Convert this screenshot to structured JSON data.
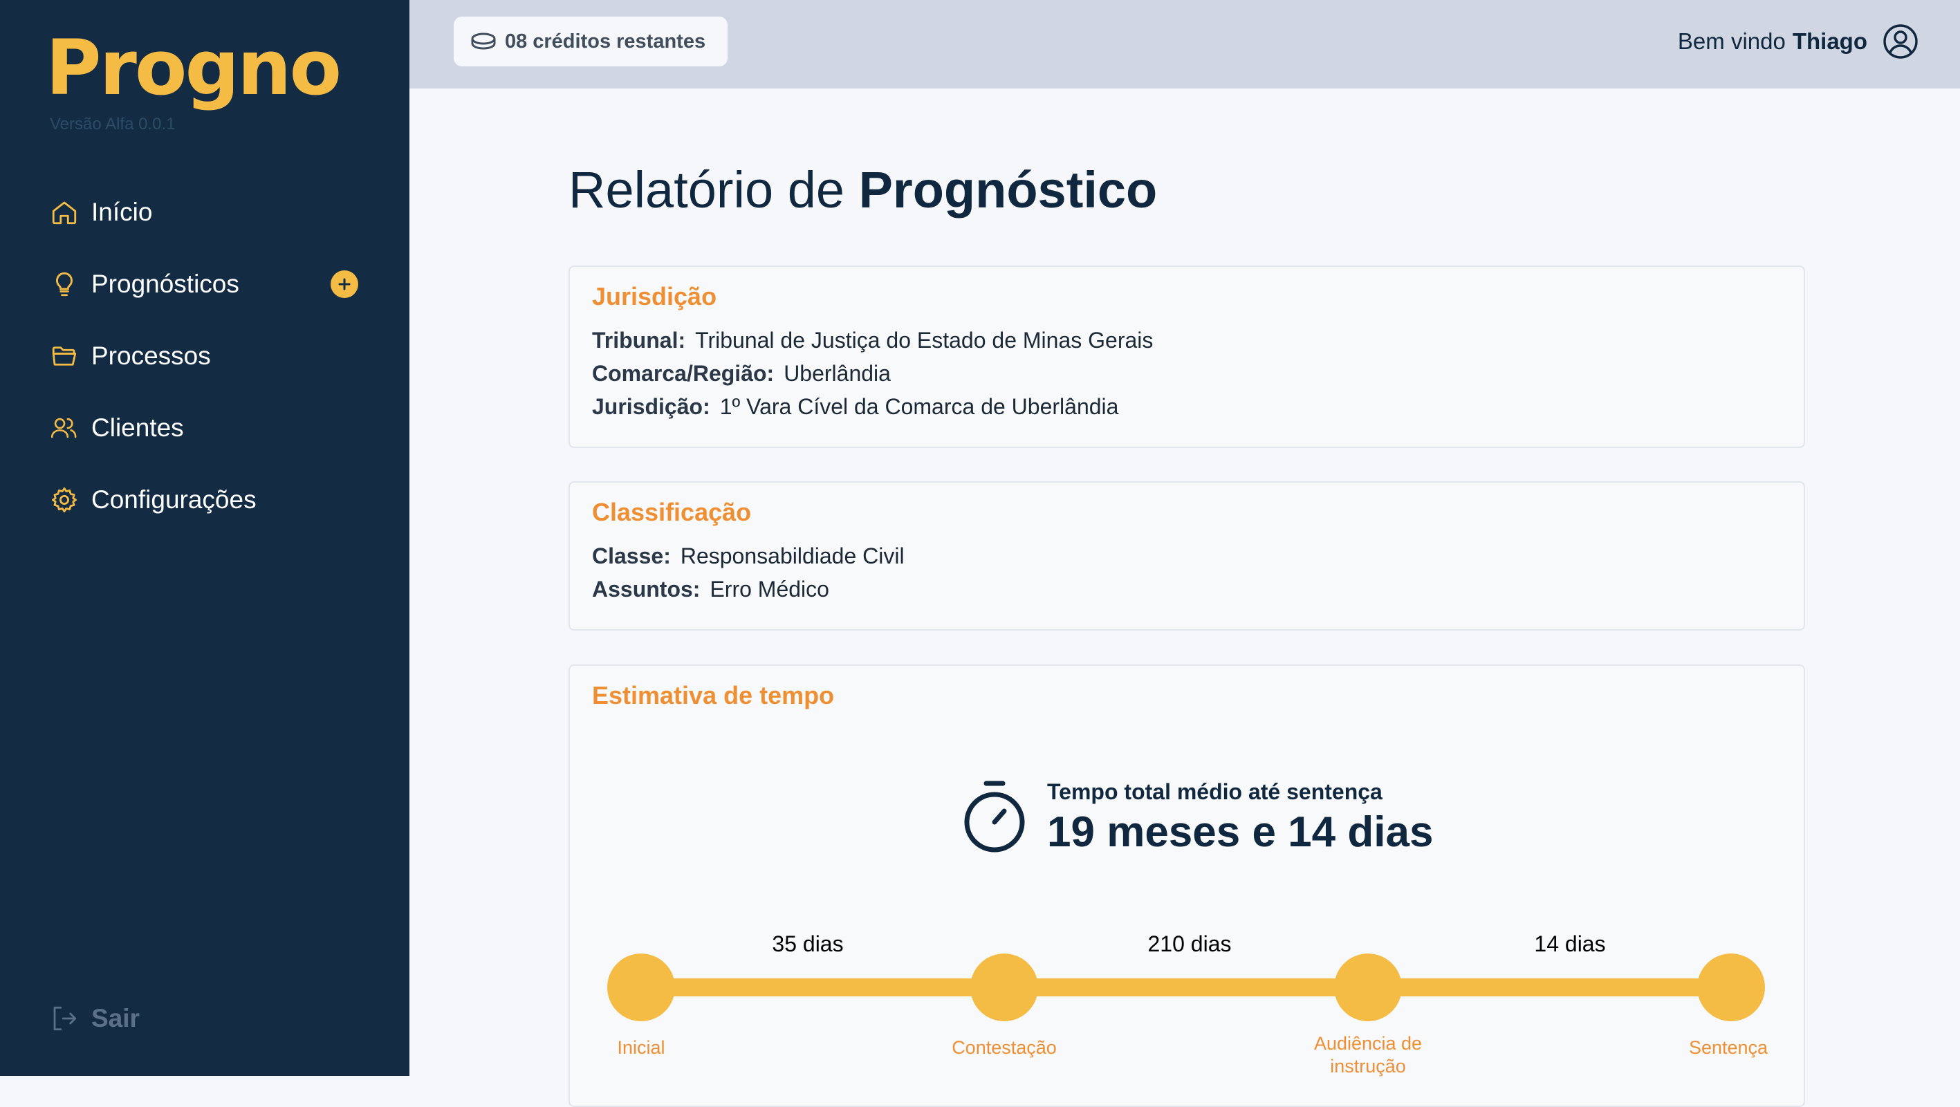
{
  "app": {
    "logo": "Progno",
    "version": "Versão Alfa 0.0.1"
  },
  "sidebar": {
    "items": [
      {
        "label": "Início",
        "icon": "home-icon"
      },
      {
        "label": "Prognósticos",
        "icon": "lightbulb-icon"
      },
      {
        "label": "Processos",
        "icon": "folder-icon"
      },
      {
        "label": "Clientes",
        "icon": "users-icon"
      },
      {
        "label": "Configurações",
        "icon": "gear-icon"
      }
    ],
    "logout_label": "Sair"
  },
  "topbar": {
    "credits_count": "08",
    "credits_label": "créditos restantes",
    "welcome_prefix": "Bem vindo",
    "user_name": "Thiago"
  },
  "page": {
    "title_prefix": "Relatório de",
    "title_bold": "Prognóstico"
  },
  "jurisdicao": {
    "heading": "Jurisdição",
    "fields": [
      {
        "key": "Tribunal:",
        "value": "Tribunal de Justiça do Estado de Minas Gerais"
      },
      {
        "key": "Comarca/Região:",
        "value": "Uberlândia"
      },
      {
        "key": "Jurisdição:",
        "value": "1º Vara Cível da Comarca de Uberlândia"
      }
    ]
  },
  "classificacao": {
    "heading": "Classificação",
    "fields": [
      {
        "key": "Classe:",
        "value": "Responsabildiade Civil"
      },
      {
        "key": "Assuntos:",
        "value": "Erro Médico"
      }
    ]
  },
  "estimativa": {
    "heading": "Estimativa de tempo",
    "total_label": "Tempo total médio até sentença",
    "total_value": "19 meses e 14 dias",
    "stages": [
      "Inicial",
      "Contestação",
      "Audiência de instrução",
      "Sentença"
    ],
    "durations": [
      "35 dias",
      "210 dias",
      "14 dias"
    ]
  },
  "colors": {
    "sidebar_bg": "#132c44",
    "brand_yellow": "#f4bc44",
    "accent_orange": "#ee8f33",
    "topbar_bg": "#d0d7e2"
  }
}
